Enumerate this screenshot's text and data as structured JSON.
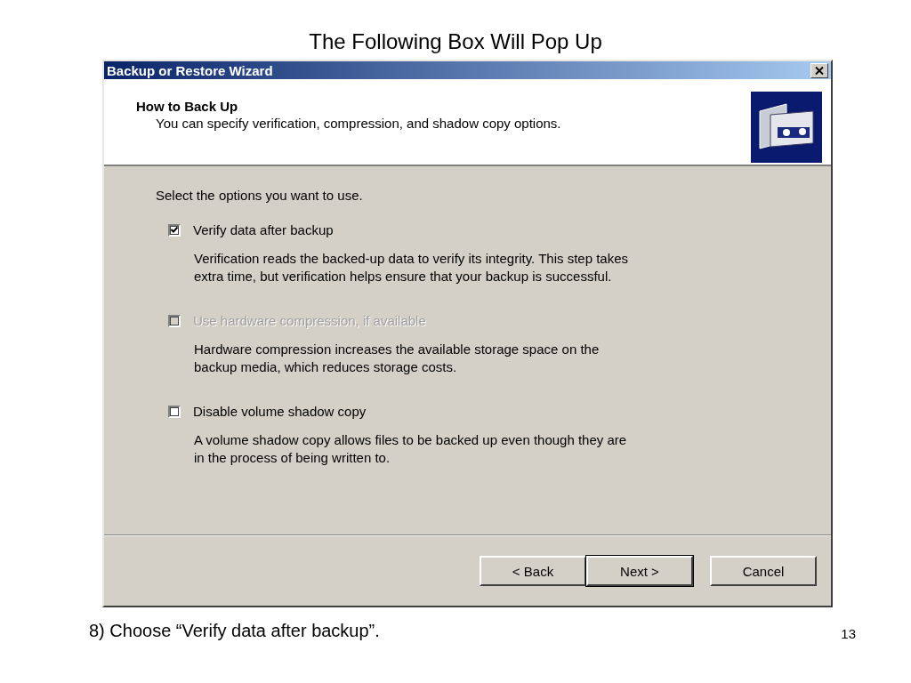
{
  "slide": {
    "title": "The Following Box Will Pop Up",
    "caption": "8) Choose “Verify data after backup”.",
    "page_number": "13"
  },
  "window": {
    "title": "Backup or Restore Wizard"
  },
  "header": {
    "heading": "How to Back Up",
    "subtitle": "You can specify verification, compression, and shadow copy options."
  },
  "prompt": "Select the options you want to use.",
  "options": [
    {
      "label": "Verify data after backup",
      "checked": true,
      "disabled": false,
      "description": "Verification reads the backed-up data to verify its integrity. This step takes extra time, but verification helps ensure that your backup is successful."
    },
    {
      "label": "Use hardware compression, if available",
      "checked": false,
      "disabled": true,
      "description": "Hardware compression increases the available storage space on the backup media, which reduces storage costs."
    },
    {
      "label": "Disable volume shadow copy",
      "checked": false,
      "disabled": false,
      "description": "A volume shadow copy allows files to be backed up even though they are in the process of being written to."
    }
  ],
  "buttons": [
    {
      "label": "< Back",
      "default": false
    },
    {
      "label": "Next >",
      "default": true
    },
    {
      "label": "Cancel",
      "default": false
    }
  ]
}
